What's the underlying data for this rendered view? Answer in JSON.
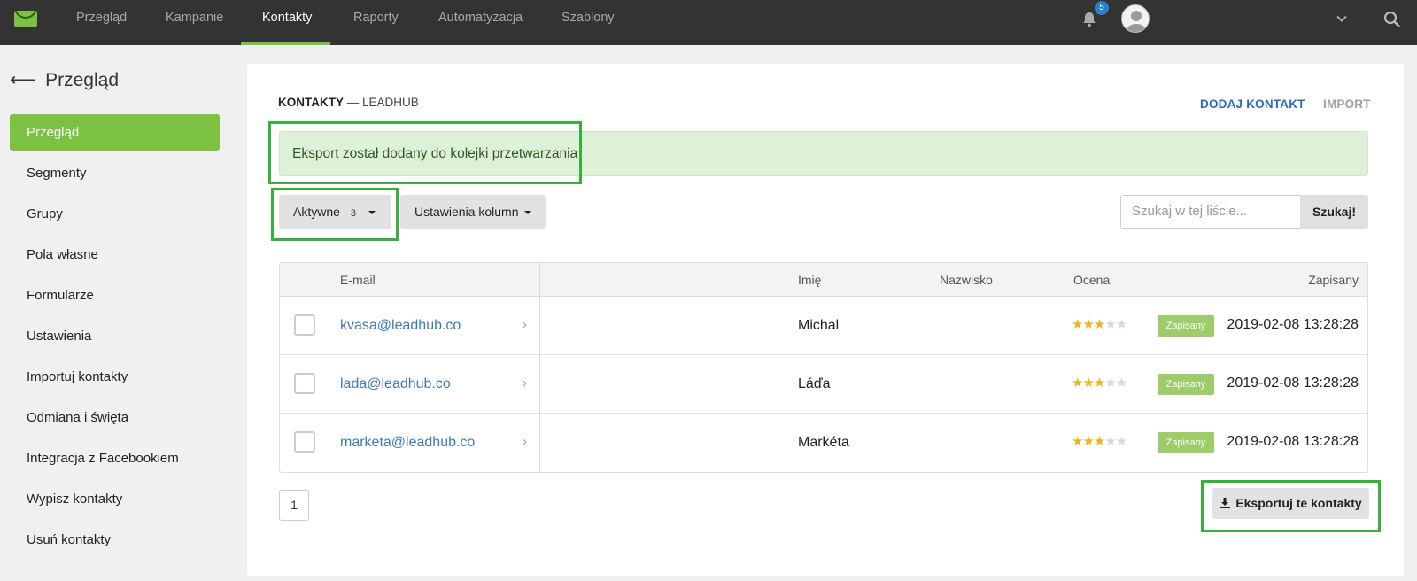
{
  "topnav": {
    "items": [
      {
        "label": "Przegląd"
      },
      {
        "label": "Kampanie"
      },
      {
        "label": "Kontakty",
        "active": true
      },
      {
        "label": "Raporty"
      },
      {
        "label": "Automatyzacja"
      },
      {
        "label": "Szablony"
      }
    ],
    "notification_count": "5",
    "icons": [
      "envelope-logo-icon",
      "bell-icon",
      "avatar",
      "chevron-down-icon",
      "search-icon"
    ]
  },
  "sidebar": {
    "back_label": "Przegląd",
    "items": [
      {
        "label": "Przegląd",
        "active": true
      },
      {
        "label": "Segmenty"
      },
      {
        "label": "Grupy"
      },
      {
        "label": "Pola własne"
      },
      {
        "label": "Formularze"
      },
      {
        "label": "Ustawienia"
      },
      {
        "label": "Importuj kontakty"
      },
      {
        "label": "Odmiana i święta"
      },
      {
        "label": "Integracja z Facebookiem"
      },
      {
        "label": "Wypisz kontakty"
      },
      {
        "label": "Usuń kontakty"
      }
    ]
  },
  "main": {
    "breadcrumb": {
      "section": "KONTAKTY",
      "separator": "—",
      "list": "LEADHUB"
    },
    "actions": {
      "add": "DODAJ KONTAKT",
      "import": "IMPORT"
    },
    "alert": "Eksport został dodany do kolejki przetwarzania",
    "filter": {
      "label": "Aktywne",
      "count": "3"
    },
    "columns_button": "Ustawienia kolumn",
    "search": {
      "placeholder": "Szukaj w tej liście...",
      "button": "Szukaj!"
    },
    "table": {
      "headers": {
        "email": "E-mail",
        "first_name": "Imię",
        "last_name": "Nazwisko",
        "rating": "Ocena",
        "status": "Zapisany"
      },
      "rows": [
        {
          "email": "kvasa@leadhub.co",
          "first_name": "Michal",
          "last_name": "",
          "rating": 3,
          "rating_max": 5,
          "status": "Zapisany",
          "date": "2019-02-08 13:28:28"
        },
        {
          "email": "lada@leadhub.co",
          "first_name": "Láďa",
          "last_name": "",
          "rating": 3,
          "rating_max": 5,
          "status": "Zapisany",
          "date": "2019-02-08 13:28:28"
        },
        {
          "email": "marketa@leadhub.co",
          "first_name": "Markéta",
          "last_name": "",
          "rating": 3,
          "rating_max": 5,
          "status": "Zapisany",
          "date": "2019-02-08 13:28:28"
        }
      ]
    },
    "pagination": {
      "current": "1"
    },
    "export_button": "Eksportuj te kontakty"
  },
  "colors": {
    "accent": "#7cc142",
    "topbar": "#333333",
    "link": "#3d7ab8",
    "highlight": "#36b23a",
    "alert_bg": "#dff0d8"
  }
}
